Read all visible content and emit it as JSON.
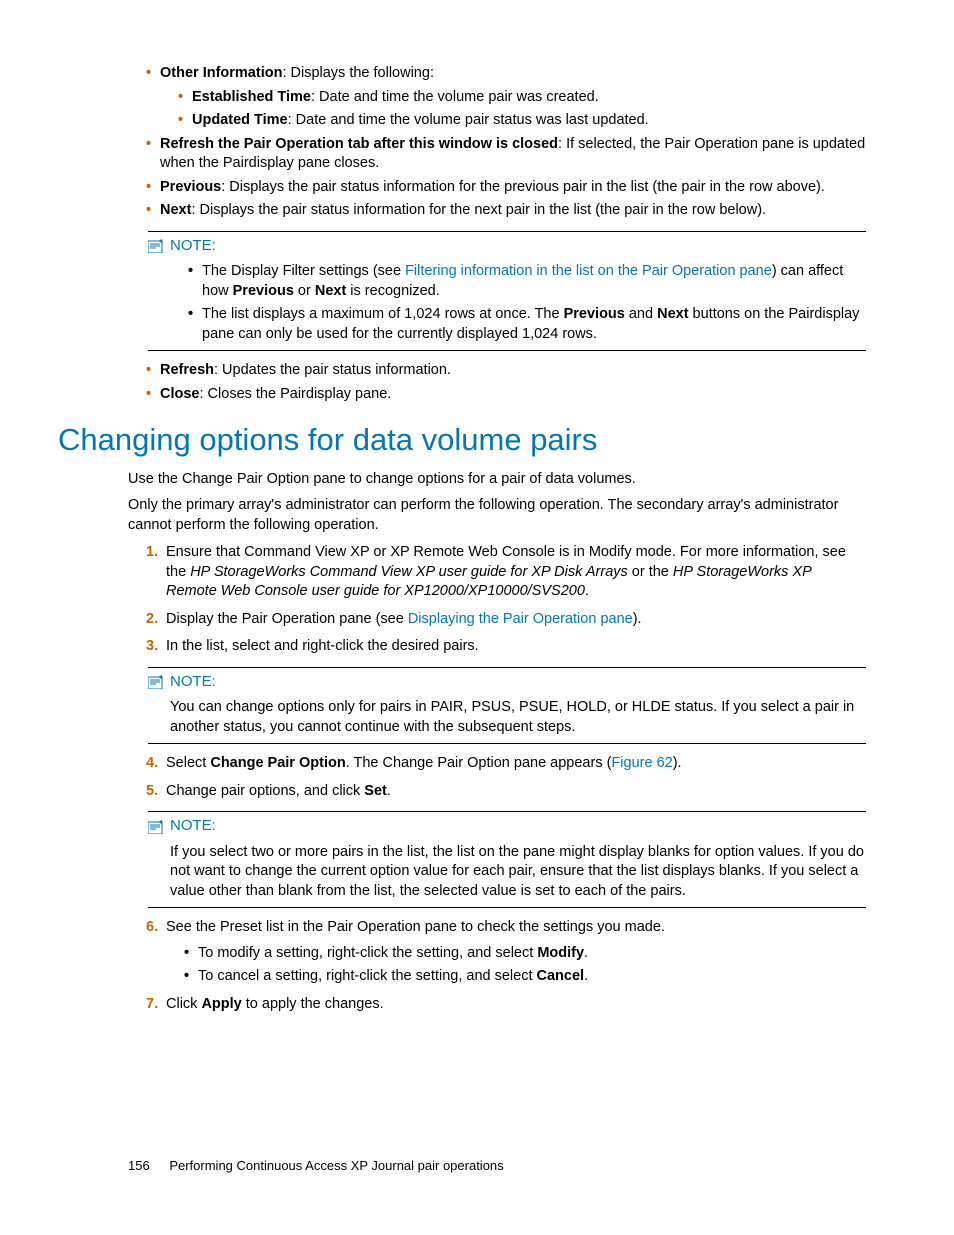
{
  "top_bullets": {
    "other_info": {
      "bold": "Other Information",
      "rest": ": Displays the following:"
    },
    "established": {
      "bold": "Established Time",
      "rest": ": Date and time the volume pair was created."
    },
    "updated": {
      "bold": "Updated Time",
      "rest": ": Date and time the volume pair status was last updated."
    },
    "refresh_tab": {
      "bold": "Refresh the Pair Operation tab after this window is closed",
      "rest": ": If selected, the Pair Operation pane is updated when the Pairdisplay pane closes."
    },
    "previous": {
      "bold": "Previous",
      "rest": ": Displays the pair status information for the previous pair in the list (the pair in the row above)."
    },
    "next": {
      "bold": "Next",
      "rest": ": Displays the pair status information for the next pair in the list (the pair in the row below)."
    }
  },
  "note1": {
    "label": "NOTE:",
    "b1a": "The Display Filter settings (see ",
    "b1link": "Filtering information in the list on the Pair Operation pane",
    "b1b": ") can affect how ",
    "b1prev": "Previous",
    "b1or": " or ",
    "b1next": "Next",
    "b1c": " is recognized.",
    "b2a": "The list displays a maximum of 1,024 rows at once. The ",
    "b2prev": "Previous",
    "b2and": " and ",
    "b2next": "Next",
    "b2b": " buttons on the Pairdisplay pane can only be used for the currently displayed 1,024 rows."
  },
  "lower_bullets": {
    "refresh": {
      "bold": "Refresh",
      "rest": ": Updates the pair status information."
    },
    "close": {
      "bold": "Close",
      "rest": ": Closes the Pairdisplay pane."
    }
  },
  "heading": "Changing options for data volume pairs",
  "intro1": "Use the Change Pair Option pane to change options for a pair of data volumes.",
  "intro2": "Only the primary array's administrator can perform the following operation. The secondary array's administrator cannot perform the following operation.",
  "steps": {
    "s1a": "Ensure that Command View XP or XP Remote Web Console is in Modify mode. For more information, see the ",
    "s1i1": "HP StorageWorks Command View XP user guide for XP Disk Arrays",
    "s1mid": " or the ",
    "s1i2": "HP StorageWorks XP Remote Web Console user guide for XP12000/XP10000/SVS200",
    "s1end": ".",
    "s2a": "Display the Pair Operation pane (see ",
    "s2link": "Displaying the Pair Operation pane",
    "s2b": ").",
    "s3": "In the list, select and right-click the desired pairs.",
    "s4a": "Select ",
    "s4bold": "Change Pair Option",
    "s4b": ". The Change Pair Option pane appears (",
    "s4link": "Figure 62",
    "s4c": ").",
    "s5a": "Change pair options, and click ",
    "s5bold": "Set",
    "s5b": ".",
    "s6": "See the Preset list in the Pair Operation pane to check the settings you made.",
    "s6_sub1a": "To modify a setting, right-click the setting, and select ",
    "s6_sub1b": "Modify",
    "s6_sub1c": ".",
    "s6_sub2a": "To cancel a setting, right-click the setting, and select ",
    "s6_sub2b": "Cancel",
    "s6_sub2c": ".",
    "s7a": "Click ",
    "s7bold": "Apply",
    "s7b": " to apply the changes."
  },
  "note2": {
    "label": "NOTE:",
    "text": "You can change options only for pairs in PAIR, PSUS, PSUE, HOLD, or HLDE status. If you select a pair in another status, you cannot continue with the subsequent steps."
  },
  "note3": {
    "label": "NOTE:",
    "text": "If you select two or more pairs in the list, the list on the pane might display blanks for option values. If you do not want to change the current option value for each pair, ensure that the list displays blanks. If you select a value other than blank from the list, the selected value is set to each of the pairs."
  },
  "footer": {
    "page": "156",
    "title": "Performing Continuous Access XP Journal pair operations"
  }
}
